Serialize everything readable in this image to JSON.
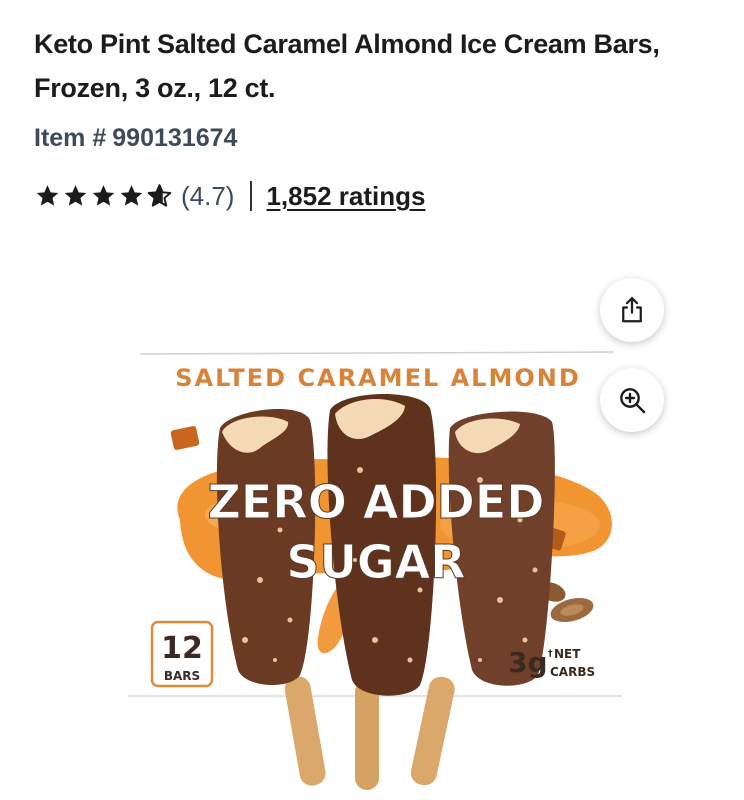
{
  "product": {
    "title": "Keto Pint Salted Caramel Almond Ice Cream Bars, Frozen, 3 oz., 12 ct.",
    "item_label": "Item #",
    "item_number": "990131674",
    "rating_value": "(4.7)",
    "rating_stars": 4.7,
    "ratings_link": "1,852 ratings"
  },
  "gallery": {
    "share_icon": "share-icon",
    "zoom_icon": "zoom-in-icon",
    "box_flavor": "SALTED CARAMEL ALMOND",
    "headline_line1": "ZERO ADDED",
    "headline_line2": "SUGAR",
    "count_number": "12",
    "count_label": "BARS",
    "carbs_value": "3g",
    "carbs_label_1": "NET",
    "carbs_label_2": "CARBS",
    "carbs_dagger": "†"
  },
  "colors": {
    "star": "#1c1c1c",
    "text_secondary": "#3c4a5a",
    "flavor_orange": "#d9833a",
    "chocolate": "#6b3a22",
    "caramel": "#f08a1c",
    "stick": "#d9a86a"
  }
}
